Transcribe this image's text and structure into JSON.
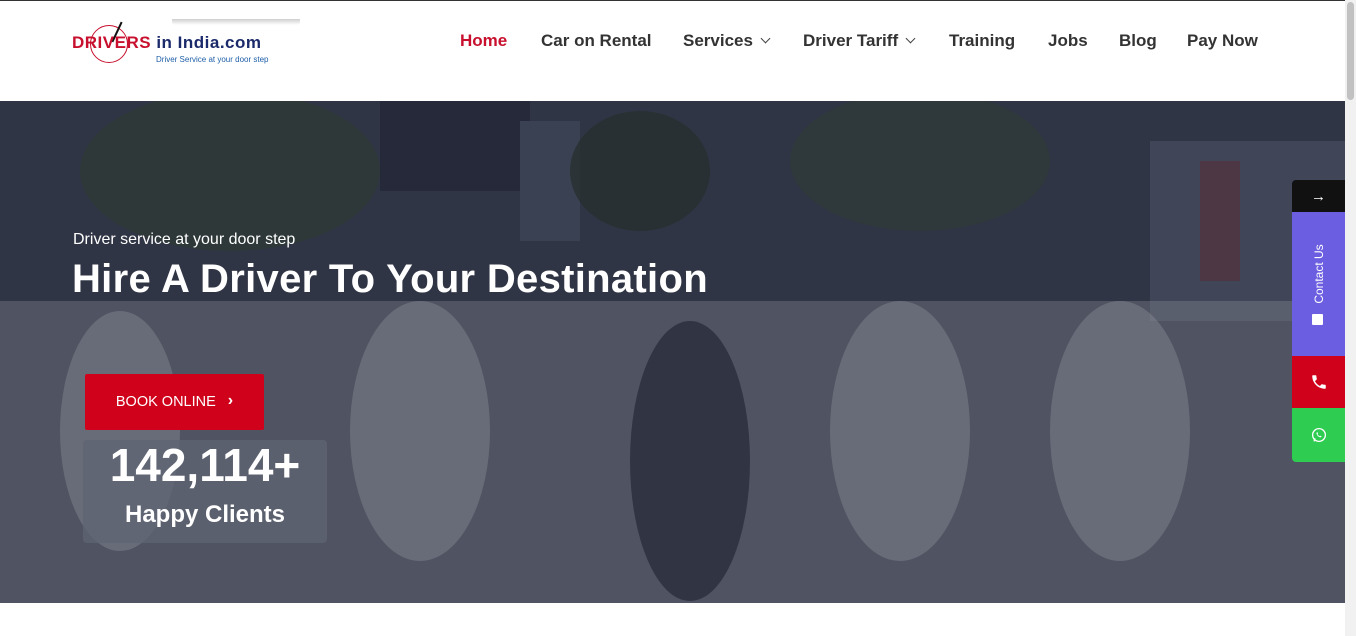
{
  "logo": {
    "brand_red": "DRIVERS",
    "brand_dark": "in India.com",
    "tagline": "Driver Service at your door step"
  },
  "nav": {
    "items": [
      {
        "label": "Home",
        "active": true,
        "dropdown": false
      },
      {
        "label": "Car on Rental",
        "active": false,
        "dropdown": false
      },
      {
        "label": "Services",
        "active": false,
        "dropdown": true
      },
      {
        "label": "Driver Tariff",
        "active": false,
        "dropdown": true
      },
      {
        "label": "Training",
        "active": false,
        "dropdown": false
      },
      {
        "label": "Jobs",
        "active": false,
        "dropdown": false
      },
      {
        "label": "Blog",
        "active": false,
        "dropdown": false
      },
      {
        "label": "Pay Now",
        "active": false,
        "dropdown": false
      }
    ]
  },
  "hero": {
    "subtitle": "Driver service at your door step",
    "title": "Hire A Driver To Your Destination",
    "cta_label": "BOOK ONLINE",
    "stat_value": "142,114+",
    "stat_label": "Happy Clients"
  },
  "floating": {
    "arrow": "→",
    "contact_label": "Contact Us",
    "phone_icon": "phone-icon",
    "whatsapp_icon": "whatsapp-icon"
  },
  "colors": {
    "accent": "#d0021b",
    "brand_red": "#c8102e",
    "contact_purple": "#6b5ee0",
    "whatsapp_green": "#2ecc50"
  }
}
